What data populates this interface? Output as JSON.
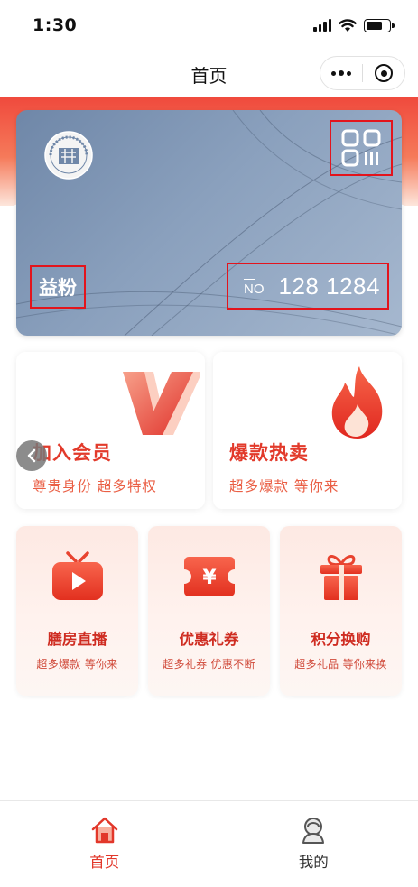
{
  "status_bar": {
    "time": "1:30"
  },
  "nav": {
    "title": "首页",
    "capsule_more": "more-options",
    "capsule_close": "close-miniprogram"
  },
  "member_card": {
    "name": "益粉",
    "no_label": "NO",
    "member_number": "128 1284",
    "logo_text": "TAE TEA",
    "logo_char": "益"
  },
  "features": [
    {
      "title": "加入会员",
      "subtitle": "尊贵身份 超多特权",
      "icon": "v-badge-icon"
    },
    {
      "title": "爆款热卖",
      "subtitle": "超多爆款 等你来",
      "icon": "fire-icon"
    }
  ],
  "services": [
    {
      "title": "膳房直播",
      "subtitle": "超多爆款 等你来",
      "icon": "tv-play-icon"
    },
    {
      "title": "优惠礼券",
      "subtitle": "超多礼券 优惠不断",
      "icon": "coupon-icon"
    },
    {
      "title": "积分换购",
      "subtitle": "超多礼品 等你来换",
      "icon": "gift-icon"
    }
  ],
  "tabbar": [
    {
      "label": "首页",
      "active": true
    },
    {
      "label": "我的",
      "active": false
    }
  ],
  "colors": {
    "brand_red": "#e2372a",
    "card_blue": "#7f96b5",
    "annotation_red": "#e3141c"
  }
}
